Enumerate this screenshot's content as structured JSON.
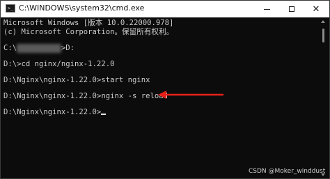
{
  "window": {
    "title": "C:\\WINDOWS\\system32\\cmd.exe"
  },
  "console": {
    "lines": [
      "Microsoft Windows [版本 10.0.22000.978]",
      "(c) Microsoft Corporation。保留所有权利。",
      "",
      "",
      "D:\\>cd nginx/nginx-1.22.0",
      "",
      "D:\\Nginx\\nginx-1.22.0>start nginx",
      "",
      "D:\\Nginx\\nginx-1.22.0>nginx -s reload",
      "",
      "D:\\Nginx\\nginx-1.22.0>"
    ],
    "redacted_prompt_prefix": "C:\\",
    "redacted_prompt_suffix": ">D:"
  },
  "annotation": {
    "arrow_color": "#e8201a"
  },
  "watermark": {
    "text": "CSDN @Moker_winddust"
  },
  "colors": {
    "console_bg": "#0c0c0c",
    "console_text": "#cccccc",
    "titlebar_bg": "#ffffff"
  }
}
